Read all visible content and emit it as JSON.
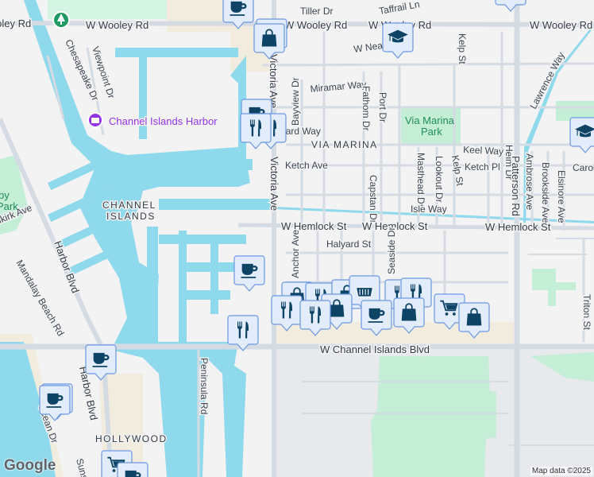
{
  "map": {
    "streets": [
      "W Wooley Rd",
      "Tiller Dr",
      "Taffrail Ln",
      "W Neap",
      "Kelp St",
      "Chesapeake Dr",
      "Viewpoint Dr",
      "Miramar Way",
      "Bayview Dr",
      "Fathom Dr",
      "Port Dr",
      "Leeward Way",
      "Keel Way",
      "Ketch Ave",
      "Ketch Pl",
      "Masthead Dr",
      "Lookout Dr",
      "Helm Dr",
      "Patterson Rd",
      "Ambrose Ave",
      "Brookside Ave",
      "Elsinore Ave",
      "Carob",
      "Lawrence Way",
      "Capstan Dr",
      "Isle Way",
      "Victoria Ave",
      "W Hemlock St",
      "Halyard St",
      "Anchor Ave",
      "Seaside Dr",
      "Triton St",
      "W Channel Islands Blvd",
      "Harbor Blvd",
      "Mandalay Beach Rd",
      "Peninsula Rd",
      "Ocean Dr",
      "Sunset",
      "Silkirk Ave"
    ],
    "poi": {
      "harbor": "Channel Islands Harbor",
      "park": "Via Marina",
      "park2": "Park",
      "park_left": "Park",
      "park_left2": "by"
    },
    "areas": {
      "via_marina": "VIA MARINA",
      "channel": "CHANNEL",
      "islands": "ISLANDS",
      "hollywood": "HOLLYWOOD"
    },
    "colors": {
      "water": "#8fd9ec",
      "park": "#c4eed6",
      "marker_bg": "#e3ecfb",
      "marker_border": "#6b97e0",
      "icon": "#0d4466",
      "poi_purple": "#9334e6"
    }
  },
  "attribution": "Map data ©2025",
  "logo": "Google"
}
